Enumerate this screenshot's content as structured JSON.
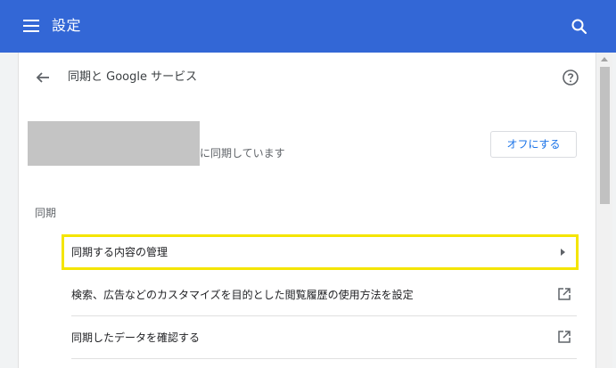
{
  "topbar": {
    "title": "設定",
    "menu_icon": "hamburger-menu-icon",
    "search_icon": "search-icon",
    "background": "#3367d6"
  },
  "page": {
    "title": "同期と Google サービス",
    "back_icon": "arrow-left-icon",
    "help_icon": "help-circle-icon"
  },
  "account": {
    "syncing_text": "に同期しています",
    "off_button_label": "オフにする"
  },
  "sync_section": {
    "label": "同期",
    "items": [
      {
        "label": "同期する内容の管理",
        "icon": "chevron-right-icon"
      },
      {
        "label": "検索、広告などのカスタマイズを目的とした閲覧履歴の使用方法を設定",
        "icon": "external-link-icon"
      },
      {
        "label": "同期したデータを確認する",
        "icon": "external-link-icon"
      }
    ]
  },
  "colors": {
    "accent": "#1a73e8",
    "highlight": "#f4e500"
  }
}
